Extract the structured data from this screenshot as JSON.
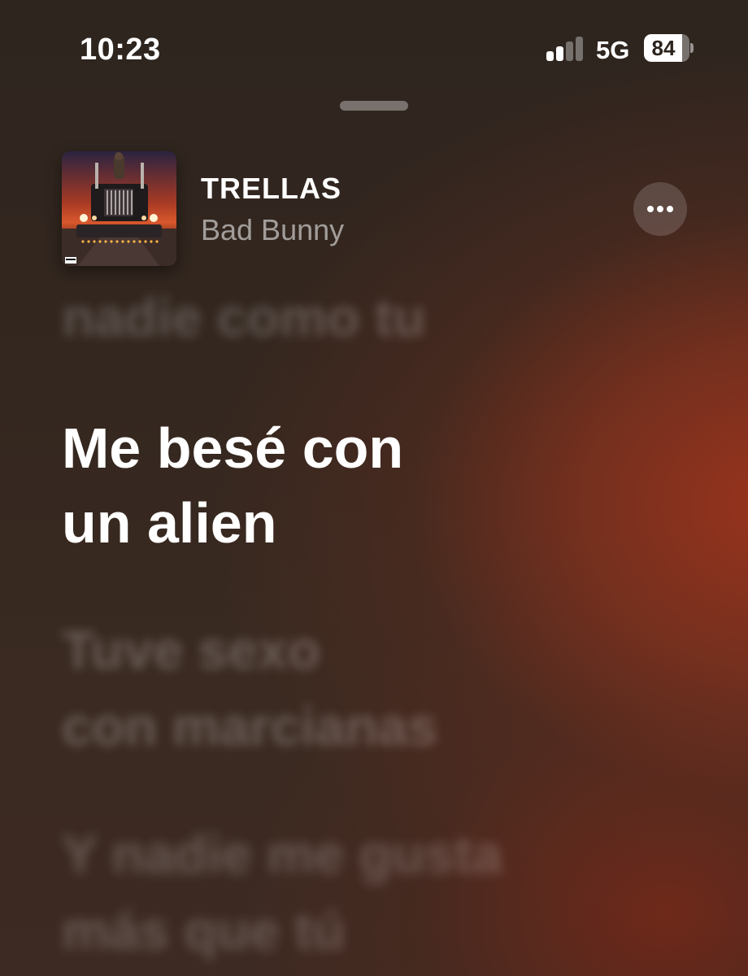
{
  "status_bar": {
    "time": "10:23",
    "network": "5G",
    "battery_level": "84",
    "battery_fraction": 0.84,
    "signal_bars_active": 2,
    "signal_bars_total": 4
  },
  "now_playing": {
    "title": "TRELLAS",
    "artist": "Bad Bunny",
    "artwork_icon": "album-artwork-truck",
    "more_icon": "ellipsis-icon"
  },
  "lyrics": {
    "previous": "nadie como tu",
    "current": "Me besé con\nun alien",
    "next": [
      "Tuve sexo\ncon marcianas",
      "Y nadie me gusta\nmás que tú"
    ]
  },
  "colors": {
    "background_dark": "#2e251f",
    "background_accent": "#9e341c"
  }
}
